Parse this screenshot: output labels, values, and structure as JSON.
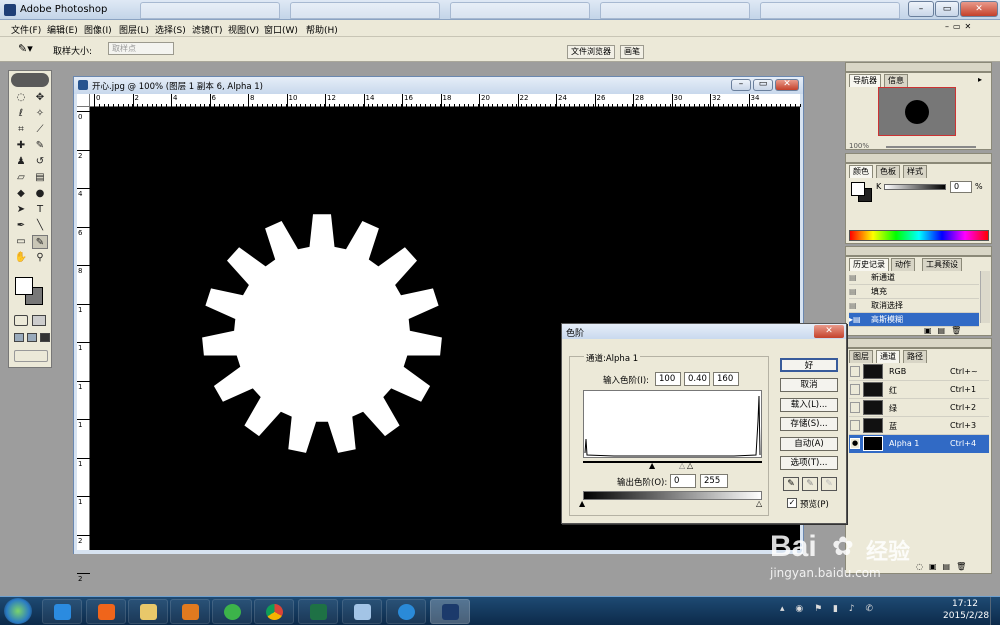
{
  "app": {
    "title": "Adobe Photoshop"
  },
  "menubar": [
    "文件(F)",
    "编辑(E)",
    "图像(I)",
    "图层(L)",
    "选择(S)",
    "滤镜(T)",
    "视图(V)",
    "窗口(W)",
    "帮助(H)"
  ],
  "options": {
    "sample_label": "取样大小:",
    "sample_value": "取样点",
    "wells": [
      "文件浏览器",
      "画笔"
    ]
  },
  "document": {
    "title": "开心.jpg @ 100% (图层 1 副本 6, Alpha 1)"
  },
  "ruler": {
    "top": [
      "0",
      "2",
      "4",
      "6",
      "8",
      "10",
      "12",
      "14",
      "16",
      "18",
      "20",
      "22",
      "24",
      "26",
      "28",
      "30",
      "32",
      "34"
    ],
    "left": [
      "0",
      "2",
      "4",
      "6",
      "8",
      "1",
      "1",
      "1",
      "1",
      "1",
      "1",
      "2",
      "2"
    ]
  },
  "navigator": {
    "tabs": [
      "导航器",
      "信息"
    ],
    "zoom": "100%"
  },
  "color": {
    "tabs": [
      "颜色",
      "色板",
      "样式"
    ],
    "channel": "K",
    "value": "0",
    "unit": "%"
  },
  "history": {
    "tabs": [
      "历史记录",
      "动作",
      "工具预设"
    ],
    "items": [
      "新通道",
      "填充",
      "取消选择",
      "高斯模糊"
    ]
  },
  "layers": {
    "tabs": [
      "图层",
      "通道",
      "路径"
    ],
    "channels": [
      {
        "name": "RGB",
        "shortcut": "Ctrl+~"
      },
      {
        "name": "红",
        "shortcut": "Ctrl+1"
      },
      {
        "name": "绿",
        "shortcut": "Ctrl+2"
      },
      {
        "name": "蓝",
        "shortcut": "Ctrl+3"
      },
      {
        "name": "Alpha 1",
        "shortcut": "Ctrl+4"
      }
    ]
  },
  "levels": {
    "title": "色阶",
    "channel": "通道:Alpha 1",
    "input_label": "输入色阶(I):",
    "input_black": "100",
    "input_gamma": "0.40",
    "input_white": "160",
    "output_label": "输出色阶(O):",
    "output_black": "0",
    "output_white": "255",
    "buttons": [
      "好",
      "取消",
      "载入(L)...",
      "存储(S)...",
      "自动(A)",
      "选项(T)..."
    ],
    "preview_label": "预览(P)"
  },
  "watermark": {
    "brand": "Bai",
    "brand2": "经验",
    "url": "jingyan.baidu.com"
  },
  "taskbar": {
    "time": "17:12",
    "date": "2015/2/28"
  },
  "colors": {
    "titlebar": "#c3d4e8",
    "panel": "#ece9d8",
    "selection": "#316ac5",
    "taskbar": "#0c2a4a"
  }
}
